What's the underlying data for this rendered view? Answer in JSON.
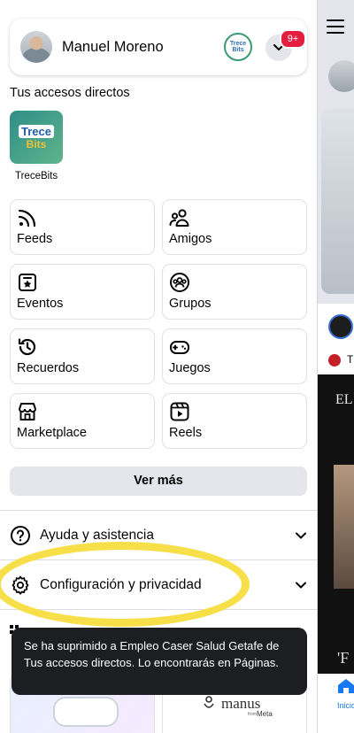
{
  "profile": {
    "name": "Manuel Moreno",
    "page_avatar_text": "Trece Bits",
    "notification_badge": "9+"
  },
  "shortcuts": {
    "title": "Tus accesos directos",
    "items": [
      {
        "label": "TreceBits",
        "logo_line1": "Trece",
        "logo_line2": "Bits"
      }
    ]
  },
  "tiles": [
    {
      "label": "Feeds",
      "icon": "feeds-icon"
    },
    {
      "label": "Amigos",
      "icon": "friends-icon"
    },
    {
      "label": "Eventos",
      "icon": "events-icon"
    },
    {
      "label": "Grupos",
      "icon": "groups-icon"
    },
    {
      "label": "Recuerdos",
      "icon": "memories-icon"
    },
    {
      "label": "Juegos",
      "icon": "games-icon"
    },
    {
      "label": "Marketplace",
      "icon": "marketplace-icon"
    },
    {
      "label": "Reels",
      "icon": "reels-icon"
    }
  ],
  "more_button": "Ver más",
  "rows": {
    "help": "Ayuda y asistencia",
    "settings": "Configuración y privacidad"
  },
  "bottom_cards": {
    "manus": "manus",
    "manus_sub": "from",
    "meta": "Meta"
  },
  "toast": {
    "message": "Se ha suprimido a Empleo Caser Salud Getafe de Tus accesos directos. Lo encontrarás en Páginas."
  },
  "right_panel": {
    "red_label": "T",
    "header_text": "EL",
    "quote_text": "'F",
    "home_label": "Inicio"
  },
  "colors": {
    "accent": "#1877f2",
    "highlight": "#f6dc3a",
    "badge": "#e41e3f",
    "toast_bg": "#1c1e21"
  }
}
